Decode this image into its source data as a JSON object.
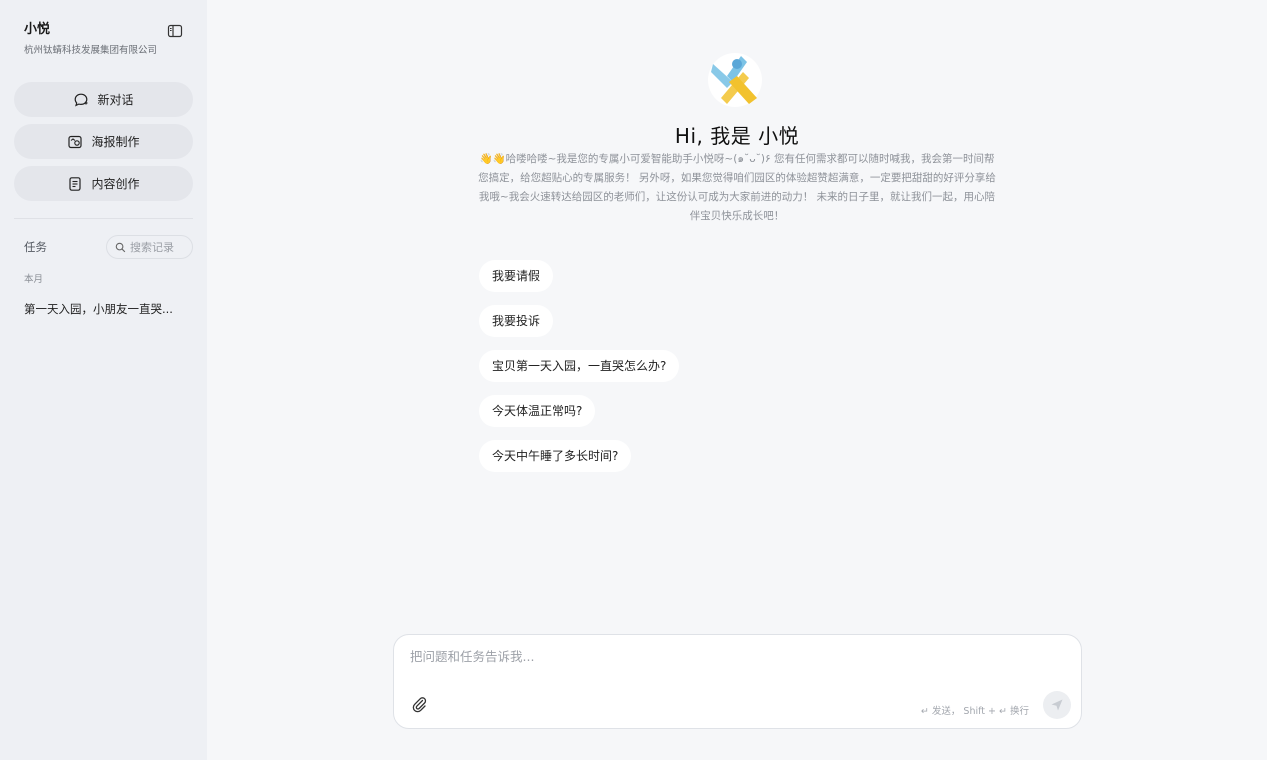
{
  "sidebar": {
    "title": "小悦",
    "subtitle": "杭州钛蜻科技发展集团有限公司",
    "nav": [
      {
        "label": "新对话",
        "icon": "chat-icon"
      },
      {
        "label": "海报制作",
        "icon": "poster-icon"
      },
      {
        "label": "内容创作",
        "icon": "document-icon"
      }
    ],
    "tasks_label": "任务",
    "search_placeholder": "搜索记录",
    "month_label": "本月",
    "history": [
      "第一天入园，小朋友一直哭..."
    ]
  },
  "main": {
    "title": "Hi, 我是 小悦",
    "description": "👋👋哈喽哈喽~我是您的专属小可爱智能助手小悦呀~(๑˘ᴗ˘)۶ 您有任何需求都可以随时喊我，我会第一时间帮您搞定，给您超贴心的专属服务！ 另外呀，如果您觉得咱们园区的体验超赞超满意，一定要把甜甜的好评分享给我哦~我会火速转达给园区的老师们，让这份认可成为大家前进的动力！ 未来的日子里，就让我们一起，用心陪伴宝贝快乐成长吧！",
    "suggestions": [
      "我要请假",
      "我要投诉",
      "宝贝第一天入园，一直哭怎么办?",
      "今天体温正常吗?",
      "今天中午睡了多长时间?"
    ]
  },
  "composer": {
    "placeholder": "把问题和任务告诉我...",
    "hint": "↵ 发送，  Shift + ↵ 换行"
  },
  "colors": {
    "sidebar_bg": "#eef0f4",
    "main_bg": "#f6f7f9",
    "logo_blue": "#7cc3e6",
    "logo_yellow": "#f2c22e"
  }
}
